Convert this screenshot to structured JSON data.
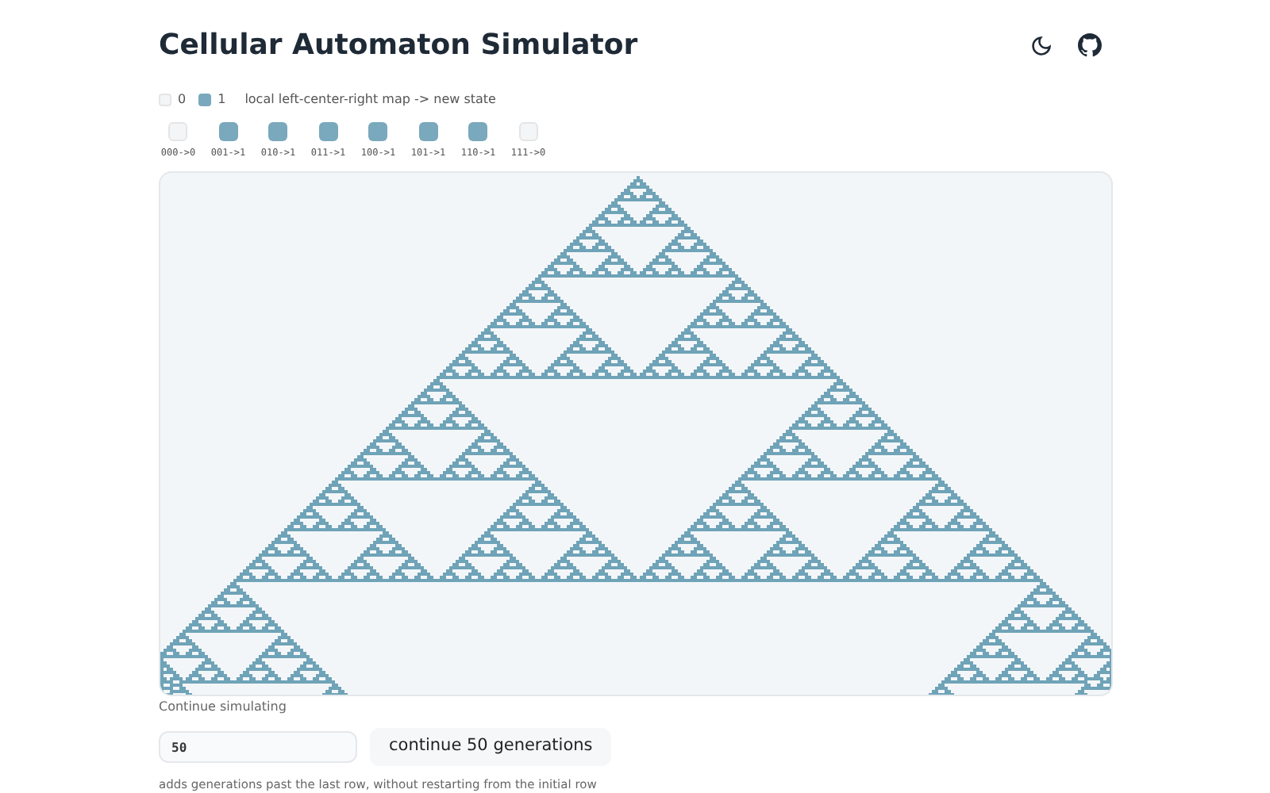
{
  "header": {
    "title": "Cellular Automaton Simulator"
  },
  "legend": [
    {
      "label": "0",
      "on": false
    },
    {
      "label": "1",
      "on": true
    }
  ],
  "legend_caption": "local left-center-right map -> new state",
  "rules": [
    {
      "label": "000->0",
      "on": false
    },
    {
      "label": "001->1",
      "on": true
    },
    {
      "label": "010->1",
      "on": true
    },
    {
      "label": "011->1",
      "on": true
    },
    {
      "label": "100->1",
      "on": true
    },
    {
      "label": "101->1",
      "on": true
    },
    {
      "label": "110->1",
      "on": true
    },
    {
      "label": "111->0",
      "on": false
    }
  ],
  "continue": {
    "heading": "Continue simulating",
    "value": "50",
    "button": "continue 50 generations",
    "hint": "adds generations past the last row, without restarting from the initial row"
  }
}
